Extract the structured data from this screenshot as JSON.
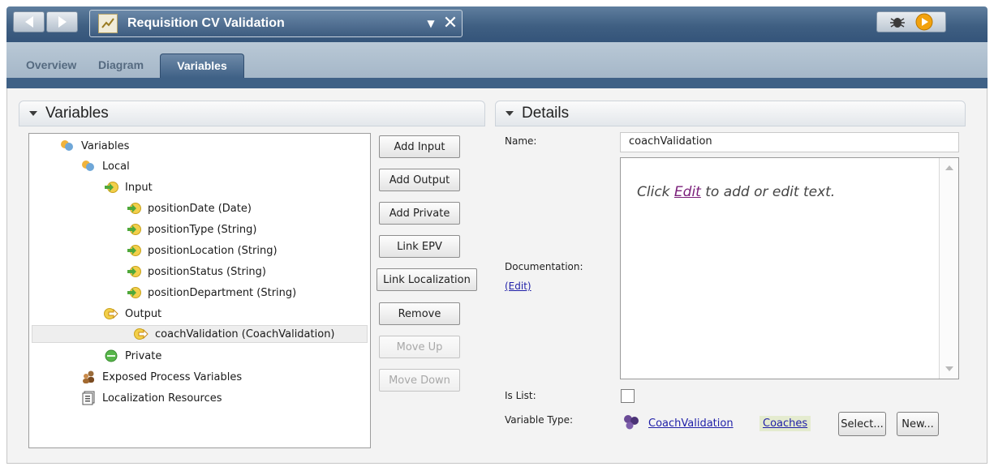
{
  "window": {
    "title": "Requisition CV Validation",
    "accent_color": "#3f6186"
  },
  "tabs": [
    {
      "label": "Overview"
    },
    {
      "label": "Diagram"
    },
    {
      "label": "Variables"
    }
  ],
  "variables_panel": {
    "title": "Variables",
    "tree": [
      {
        "label": "Variables",
        "icon": "variables-icon"
      },
      {
        "label": "Local",
        "icon": "variables-icon"
      },
      {
        "label": "Input",
        "icon": "input-arrow-icon"
      },
      {
        "label": "positionDate (Date)",
        "icon": "input-arrow-icon"
      },
      {
        "label": "positionType (String)",
        "icon": "input-arrow-icon"
      },
      {
        "label": "positionLocation (String)",
        "icon": "input-arrow-icon"
      },
      {
        "label": "positionStatus (String)",
        "icon": "input-arrow-icon"
      },
      {
        "label": "positionDepartment (String)",
        "icon": "input-arrow-icon"
      },
      {
        "label": "Output",
        "icon": "output-arrow-icon"
      },
      {
        "label": "coachValidation (CoachValidation)",
        "icon": "output-arrow-icon",
        "selected": true
      },
      {
        "label": "Private",
        "icon": "private-icon"
      },
      {
        "label": "Exposed Process Variables",
        "icon": "people-icon"
      },
      {
        "label": "Localization Resources",
        "icon": "resources-icon"
      }
    ],
    "buttons": {
      "add_input": "Add Input",
      "add_output": "Add Output",
      "add_private": "Add Private",
      "link_epv": "Link EPV",
      "link_localization": "Link Localization",
      "remove": "Remove",
      "move_up": "Move Up",
      "move_down": "Move Down"
    }
  },
  "details_panel": {
    "title": "Details",
    "name_label": "Name:",
    "name_value": "coachValidation",
    "documentation_label": "Documentation:",
    "documentation_edit": "(Edit)",
    "doc_hint_before": "Click ",
    "doc_hint_link": "Edit",
    "doc_hint_after": " to add or edit text.",
    "is_list_label": "Is List:",
    "is_list_checked": false,
    "variable_type_label": "Variable Type:",
    "variable_type_value": "CoachValidation",
    "variable_type_toolkit": "Coaches",
    "select_button": "Select...",
    "new_button": "New..."
  }
}
